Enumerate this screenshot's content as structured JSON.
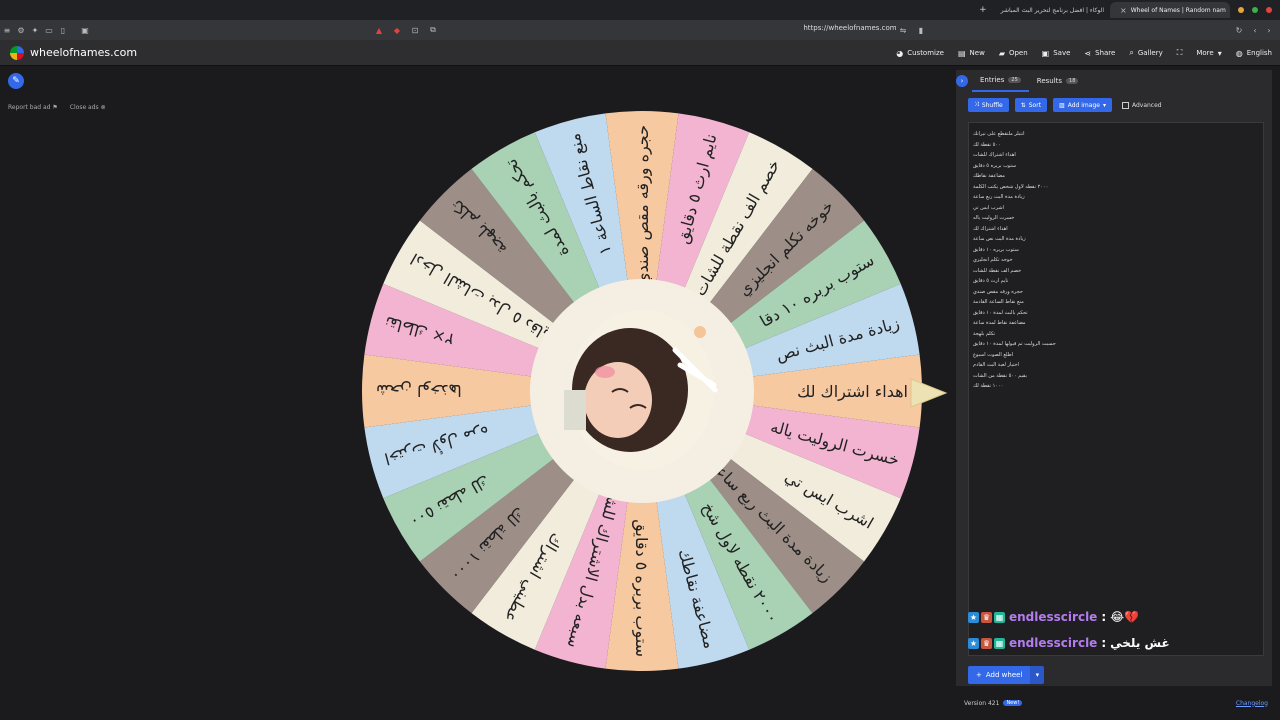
{
  "browser": {
    "tabs": [
      {
        "label": "الوكاء | افضل برنامج لتحرير البث المباشر"
      },
      {
        "label": "Wheel of Names | Random nam"
      }
    ],
    "url": "https://wheelofnames.com"
  },
  "app": {
    "logo_text": "wheelofnames.com",
    "toolbar": [
      "Customize",
      "New",
      "Open",
      "Save",
      "Share",
      "Gallery",
      "More",
      "English"
    ]
  },
  "ads": {
    "report": "Report bad ad",
    "close": "Close ads"
  },
  "wheel": {
    "segments": [
      "اهداء اشتراك لك",
      "خسرت الروليت ياله",
      "اشرب ايس تي",
      "زيادة مدة البث ربع ساعة",
      "٢٠٠٠ نقطه لاول شخ",
      "مضاعفة نقاطك",
      "ستوب بربره ٥ دقايق",
      "سبعه بدل الاشتراك للشات",
      "عطيني اشتراك",
      "١٠٠٠ نقطة لك",
      "٥٠٠ نقطه لك",
      "اخترت لأول مره",
      "شحن لوخذها",
      "نقاطك ×٢",
      "ادخل الشات بدل ٥ دقايق",
      "تكلم بلهجة",
      "تحكم بالبث لمدة",
      "منع نقاط الساعة ١",
      "حجره ورقه مقص صندي",
      "نايم ارث ٥ دقايق",
      "خصم الف نقطة للشات",
      "خوخه تكلم انجليزي",
      "ستوب بربره ١٠ دقا",
      "زيادة مدة البث نص"
    ]
  },
  "panel": {
    "tabs": [
      {
        "label": "Entries",
        "count": "25"
      },
      {
        "label": "Results",
        "count": "18"
      }
    ],
    "buttons": {
      "shuffle": "Shuffle",
      "sort": "Sort",
      "add_image": "Add image",
      "advanced": "Advanced"
    },
    "entries": [
      "انتبلر ملتقطع على نيرانك",
      "٥٠٠ نقطة لك",
      "اهداء اشتراك للشات",
      "ستوب بربره ٥ دقايق",
      "مضاعفة نقاطك",
      "٢٠٠٠ نقطه لاول شخص يكتب الكلمة",
      "زيادة مدة البث ربع ساعة",
      "اشرب ايس تي",
      "خسرت الروليت ياله",
      "اهداء اشتراك لك",
      "زيادة مدة البث نص ساعة",
      "ستوب بربره ١٠ دقايق",
      "خوخه تكلم انجليزي",
      "خصم الف نقطة للشات",
      "نايم ارث ٥ دقايق",
      "حجره ورقه مقص صندي",
      "منع نقاط الساعة القادمة",
      "تحكم بالبث لمدة ١٠ دقايق",
      "مضاعفة نقاط لمدة ساعة",
      "تكلم بلهجة",
      "حسبت الروليت تم قبولها لمدة ١٠ دقايق",
      "اطلع الصوت اسبوع",
      "اختيار لعبة البث القادم",
      "بقيم ٥٠٠ نقطة من الشات",
      "١٠٠٠ نقطة لك"
    ]
  },
  "chat": [
    {
      "user": "endlesscircle",
      "sep": ":",
      "msg": "😂💔"
    },
    {
      "user": "endlesscircle",
      "sep": ":",
      "msg": "غش يلخي"
    }
  ],
  "add_wheel": "Add wheel",
  "footer": {
    "version": "Version 421",
    "new": "New!",
    "changelog": "Changelog"
  },
  "colors": {
    "segments": [
      "#f7c9a1",
      "#f3b4d2",
      "#f1ecdc",
      "#9d8f88",
      "#a9d1b4",
      "#bfd9ef"
    ],
    "accent": "#3369e8"
  }
}
